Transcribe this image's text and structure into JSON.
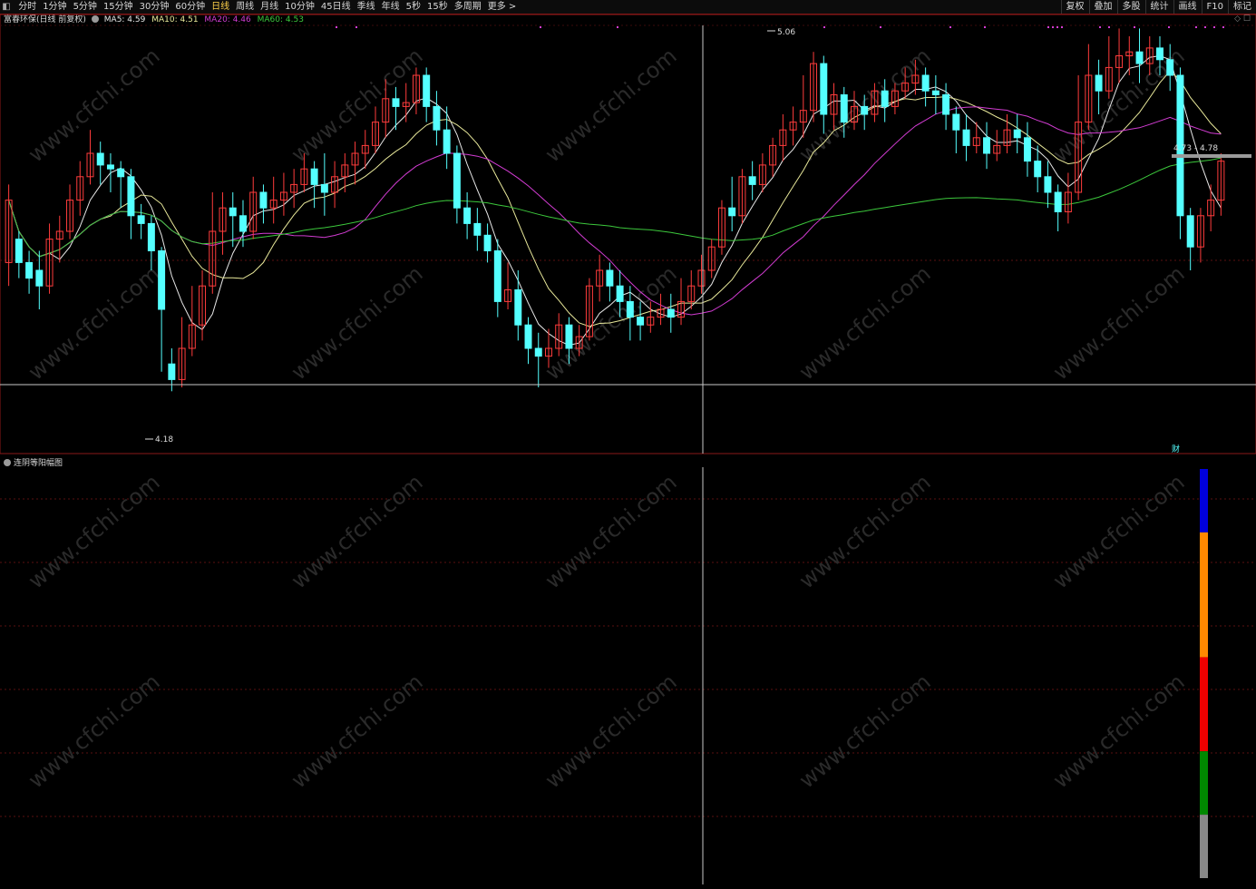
{
  "toolbar": {
    "items": [
      "分时",
      "1分钟",
      "5分钟",
      "15分钟",
      "30分钟",
      "60分钟",
      "日线",
      "周线",
      "月线",
      "10分钟",
      "45日线",
      "季线",
      "年线",
      "5秒",
      "15秒",
      "多周期",
      "更多 >"
    ],
    "active_index": 6,
    "right_items": [
      "复权",
      "叠加",
      "多股",
      "统计",
      "画线",
      "F10",
      "标记"
    ]
  },
  "main": {
    "title": "富春环保(日线 前复权)",
    "ma": [
      {
        "label": "MA5: 4.59",
        "color": "#e8e8e8"
      },
      {
        "label": "MA10: 4.51",
        "color": "#e8e89a"
      },
      {
        "label": "MA20: 4.46",
        "color": "#d23cd2"
      },
      {
        "label": "MA60: 4.53",
        "color": "#3cc83c"
      }
    ],
    "high_label": "5.06",
    "low_label": "4.18",
    "range_label": "4.73 - 4.78",
    "finance_marker": "财"
  },
  "indicator": {
    "title": "连阴等阳幅图",
    "bar_colors": [
      "#0000dd",
      "#ff8800",
      "#ee0000",
      "#008800",
      "#888888"
    ]
  },
  "watermark": "www.cfchi.com",
  "colors": {
    "up": "#ff3c3c",
    "down": "#54ffff",
    "grid": "#5a1010",
    "border": "#8a1818"
  },
  "chart_data": {
    "type": "candlestick",
    "price_range": [
      4.1,
      5.1
    ],
    "candles": [
      [
        4.52,
        4.68,
        4.46,
        4.72
      ],
      [
        4.58,
        4.52,
        4.48,
        4.6
      ],
      [
        4.52,
        4.48,
        4.44,
        4.55
      ],
      [
        4.5,
        4.46,
        4.4,
        4.55
      ],
      [
        4.46,
        4.58,
        4.44,
        4.62
      ],
      [
        4.58,
        4.6,
        4.52,
        4.64
      ],
      [
        4.6,
        4.68,
        4.58,
        4.72
      ],
      [
        4.68,
        4.74,
        4.64,
        4.78
      ],
      [
        4.74,
        4.8,
        4.72,
        4.86
      ],
      [
        4.8,
        4.77,
        4.72,
        4.83
      ],
      [
        4.77,
        4.76,
        4.7,
        4.8
      ],
      [
        4.76,
        4.74,
        4.66,
        4.78
      ],
      [
        4.74,
        4.64,
        4.58,
        4.76
      ],
      [
        4.64,
        4.62,
        4.58,
        4.67
      ],
      [
        4.62,
        4.55,
        4.5,
        4.64
      ],
      [
        4.55,
        4.4,
        4.24,
        4.56
      ],
      [
        4.26,
        4.22,
        4.19,
        4.3
      ],
      [
        4.22,
        4.3,
        4.2,
        4.38
      ],
      [
        4.3,
        4.36,
        4.28,
        4.46
      ],
      [
        4.36,
        4.46,
        4.32,
        4.5
      ],
      [
        4.46,
        4.6,
        4.44,
        4.7
      ],
      [
        4.6,
        4.66,
        4.54,
        4.7
      ],
      [
        4.66,
        4.64,
        4.56,
        4.7
      ],
      [
        4.64,
        4.6,
        4.56,
        4.68
      ],
      [
        4.6,
        4.7,
        4.58,
        4.74
      ],
      [
        4.7,
        4.66,
        4.62,
        4.72
      ],
      [
        4.66,
        4.68,
        4.62,
        4.74
      ],
      [
        4.68,
        4.7,
        4.64,
        4.75
      ],
      [
        4.7,
        4.72,
        4.66,
        4.76
      ],
      [
        4.72,
        4.76,
        4.7,
        4.8
      ],
      [
        4.76,
        4.72,
        4.66,
        4.78
      ],
      [
        4.72,
        4.7,
        4.64,
        4.8
      ],
      [
        4.7,
        4.74,
        4.66,
        4.78
      ],
      [
        4.74,
        4.77,
        4.7,
        4.8
      ],
      [
        4.77,
        4.8,
        4.72,
        4.83
      ],
      [
        4.8,
        4.82,
        4.76,
        4.86
      ],
      [
        4.82,
        4.88,
        4.8,
        4.92
      ],
      [
        4.88,
        4.94,
        4.84,
        4.99
      ],
      [
        4.94,
        4.92,
        4.86,
        4.97
      ],
      [
        4.92,
        4.93,
        4.88,
        4.98
      ],
      [
        4.93,
        5.0,
        4.9,
        5.02
      ],
      [
        5.0,
        4.92,
        4.88,
        5.02
      ],
      [
        4.92,
        4.86,
        4.82,
        4.96
      ],
      [
        4.86,
        4.8,
        4.76,
        4.92
      ],
      [
        4.8,
        4.66,
        4.62,
        4.82
      ],
      [
        4.66,
        4.62,
        4.58,
        4.7
      ],
      [
        4.62,
        4.59,
        4.55,
        4.66
      ],
      [
        4.59,
        4.55,
        4.52,
        4.62
      ],
      [
        4.55,
        4.42,
        4.38,
        4.58
      ],
      [
        4.42,
        4.45,
        4.4,
        4.52
      ],
      [
        4.45,
        4.36,
        4.32,
        4.5
      ],
      [
        4.36,
        4.3,
        4.26,
        4.38
      ],
      [
        4.3,
        4.28,
        4.2,
        4.34
      ],
      [
        4.28,
        4.3,
        4.25,
        4.35
      ],
      [
        4.3,
        4.36,
        4.28,
        4.39
      ],
      [
        4.36,
        4.3,
        4.26,
        4.38
      ],
      [
        4.3,
        4.33,
        4.28,
        4.36
      ],
      [
        4.33,
        4.46,
        4.32,
        4.48
      ],
      [
        4.46,
        4.5,
        4.42,
        4.54
      ],
      [
        4.5,
        4.46,
        4.42,
        4.52
      ],
      [
        4.46,
        4.42,
        4.38,
        4.5
      ],
      [
        4.42,
        4.38,
        4.32,
        4.46
      ],
      [
        4.38,
        4.36,
        4.32,
        4.42
      ],
      [
        4.36,
        4.38,
        4.34,
        4.42
      ],
      [
        4.38,
        4.4,
        4.36,
        4.44
      ],
      [
        4.4,
        4.38,
        4.34,
        4.44
      ],
      [
        4.38,
        4.42,
        4.36,
        4.48
      ],
      [
        4.42,
        4.46,
        4.4,
        4.5
      ],
      [
        4.46,
        4.5,
        4.44,
        4.54
      ],
      [
        4.5,
        4.56,
        4.48,
        4.58
      ],
      [
        4.56,
        4.66,
        4.54,
        4.68
      ],
      [
        4.66,
        4.64,
        4.6,
        4.74
      ],
      [
        4.64,
        4.74,
        4.62,
        4.76
      ],
      [
        4.74,
        4.72,
        4.68,
        4.78
      ],
      [
        4.72,
        4.77,
        4.7,
        4.8
      ],
      [
        4.77,
        4.82,
        4.74,
        4.84
      ],
      [
        4.82,
        4.86,
        4.78,
        4.9
      ],
      [
        4.86,
        4.88,
        4.82,
        4.92
      ],
      [
        4.88,
        4.91,
        4.84,
        5.0
      ],
      [
        4.91,
        5.03,
        4.88,
        5.06
      ],
      [
        5.03,
        4.9,
        4.85,
        5.05
      ],
      [
        4.9,
        4.95,
        4.86,
        4.98
      ],
      [
        4.95,
        4.88,
        4.84,
        4.97
      ],
      [
        4.88,
        4.92,
        4.86,
        4.96
      ],
      [
        4.92,
        4.9,
        4.86,
        4.95
      ],
      [
        4.9,
        4.96,
        4.88,
        4.98
      ],
      [
        4.96,
        4.92,
        4.88,
        4.99
      ],
      [
        4.92,
        4.96,
        4.9,
        4.98
      ],
      [
        4.96,
        4.98,
        4.94,
        5.02
      ],
      [
        4.98,
        5.0,
        4.95,
        5.04
      ],
      [
        5.0,
        4.96,
        4.92,
        5.02
      ],
      [
        4.96,
        4.95,
        4.9,
        5.0
      ],
      [
        4.95,
        4.9,
        4.86,
        4.98
      ],
      [
        4.9,
        4.86,
        4.8,
        4.92
      ],
      [
        4.86,
        4.82,
        4.78,
        4.9
      ],
      [
        4.82,
        4.84,
        4.8,
        4.88
      ],
      [
        4.84,
        4.8,
        4.76,
        4.88
      ],
      [
        4.8,
        4.82,
        4.78,
        4.86
      ],
      [
        4.82,
        4.86,
        4.8,
        4.9
      ],
      [
        4.86,
        4.84,
        4.8,
        4.9
      ],
      [
        4.84,
        4.78,
        4.74,
        4.88
      ],
      [
        4.78,
        4.74,
        4.7,
        4.82
      ],
      [
        4.74,
        4.7,
        4.66,
        4.78
      ],
      [
        4.7,
        4.65,
        4.6,
        4.72
      ],
      [
        4.65,
        4.7,
        4.62,
        4.75
      ],
      [
        4.7,
        4.88,
        4.68,
        5.0
      ],
      [
        4.88,
        5.0,
        4.86,
        5.08
      ],
      [
        5.0,
        4.96,
        4.9,
        5.04
      ],
      [
        4.96,
        5.02,
        4.94,
        5.1
      ],
      [
        5.02,
        5.05,
        4.98,
        5.12
      ],
      [
        5.05,
        5.06,
        5.0,
        5.1
      ],
      [
        5.06,
        5.03,
        4.98,
        5.12
      ],
      [
        5.03,
        5.07,
        5.0,
        5.1
      ],
      [
        5.07,
        5.04,
        5.0,
        5.1
      ],
      [
        5.04,
        5.0,
        4.96,
        5.08
      ],
      [
        5.0,
        4.64,
        4.58,
        5.02
      ],
      [
        4.64,
        4.56,
        4.5,
        4.66
      ],
      [
        4.56,
        4.64,
        4.52,
        4.66
      ],
      [
        4.64,
        4.68,
        4.6,
        4.72
      ],
      [
        4.68,
        4.78,
        4.64,
        4.8
      ]
    ],
    "indicator_bars": [
      {
        "color": "#0000dd",
        "top": 0.0,
        "bottom": 0.155
      },
      {
        "color": "#ff8800",
        "top": 0.155,
        "bottom": 0.46
      },
      {
        "color": "#ee0000",
        "top": 0.46,
        "bottom": 0.69
      },
      {
        "color": "#008800",
        "top": 0.69,
        "bottom": 0.845
      },
      {
        "color": "#888888",
        "top": 0.845,
        "bottom": 1.0
      }
    ]
  }
}
